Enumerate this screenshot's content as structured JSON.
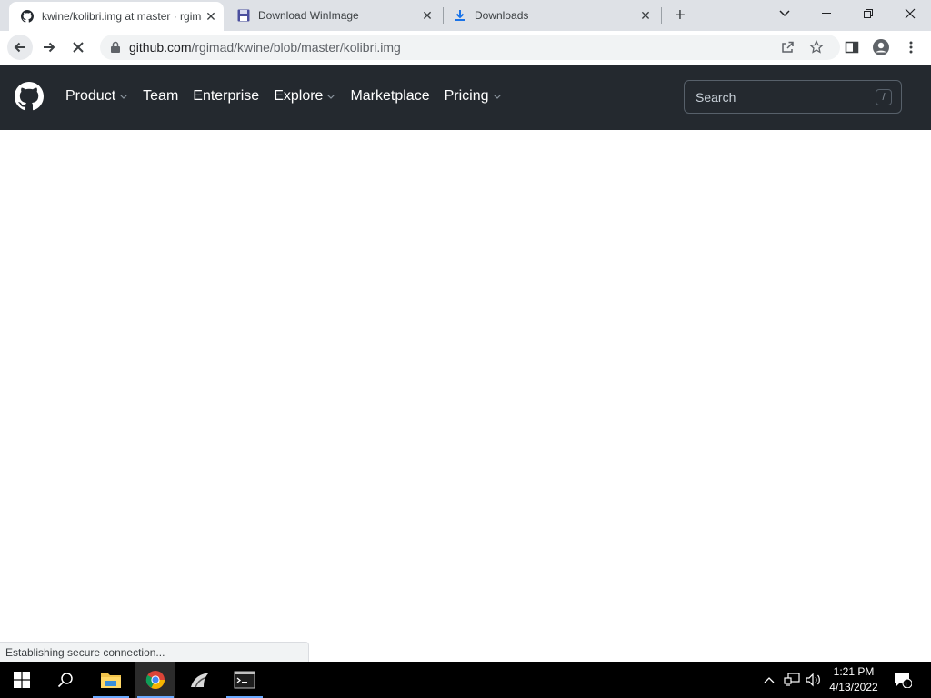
{
  "browser": {
    "tabs": [
      {
        "title": "kwine/kolibri.img at master · rgimad/kwine",
        "active": true,
        "favicon": "github-icon"
      },
      {
        "title": "Download WinImage",
        "active": false,
        "favicon": "floppy-disk-icon"
      },
      {
        "title": "Downloads",
        "active": false,
        "favicon": "download-arrow-icon"
      }
    ],
    "url": {
      "host": "github.com",
      "path": "/rgimad/kwine/blob/master/kolibri.img"
    },
    "status_text": "Establishing secure connection..."
  },
  "github": {
    "nav": [
      {
        "label": "Product",
        "dropdown": true
      },
      {
        "label": "Team",
        "dropdown": false
      },
      {
        "label": "Enterprise",
        "dropdown": false
      },
      {
        "label": "Explore",
        "dropdown": true
      },
      {
        "label": "Marketplace",
        "dropdown": false
      },
      {
        "label": "Pricing",
        "dropdown": true
      }
    ],
    "search": {
      "placeholder": "Search",
      "shortcut": "/"
    }
  },
  "taskbar": {
    "time": "1:21 PM",
    "date": "4/13/2022",
    "notification_count": "1",
    "apps": [
      "file-explorer-icon",
      "chrome-icon",
      "app-icon",
      "terminal-icon"
    ]
  },
  "colors": {
    "github_header": "#24292f",
    "tabstrip": "#dee1e6",
    "taskbar": "#000000"
  }
}
